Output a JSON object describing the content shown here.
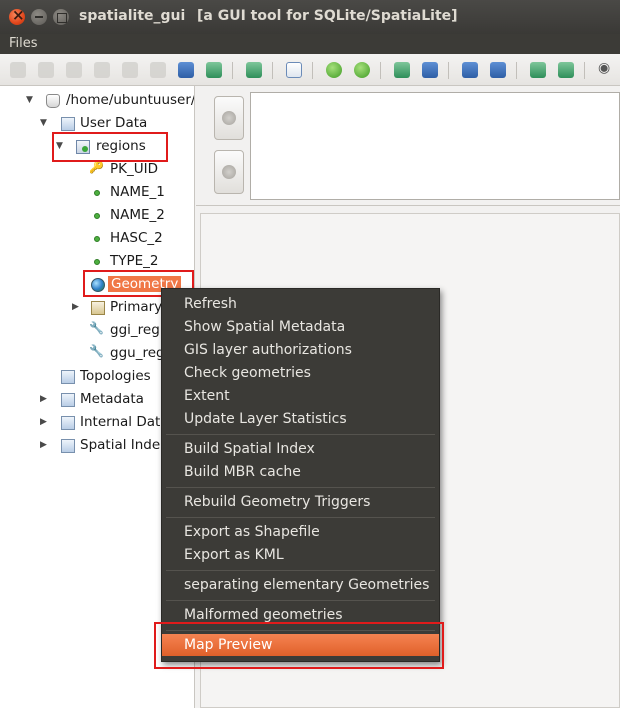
{
  "window": {
    "app_name": "spatialite_gui",
    "subtitle": "[a GUI tool for SQLite/SpatiaLite]"
  },
  "menubar": {
    "files": "Files"
  },
  "tree": {
    "root": "/home/ubuntuuser/",
    "user_data": "User Data",
    "regions": "regions",
    "columns": [
      "PK_UID",
      "NAME_1",
      "NAME_2",
      "HASC_2",
      "TYPE_2"
    ],
    "geometry": "Geometry",
    "primary": "Primary",
    "ggi": "ggi_reg",
    "ggu": "ggu_reg",
    "topologies": "Topologies",
    "metadata": "Metadata",
    "internal": "Internal Dat",
    "spatial_index": "Spatial Inde"
  },
  "context_menu": {
    "items": [
      "Refresh",
      "Show Spatial Metadata",
      "GIS layer authorizations",
      "Check geometries",
      "Extent",
      "Update Layer Statistics",
      "Build Spatial Index",
      "Build MBR cache",
      "Rebuild Geometry Triggers",
      "Export as Shapefile",
      "Export as KML",
      "separating elementary Geometries",
      "Malformed geometries",
      "Map Preview"
    ],
    "active": "Map Preview"
  },
  "colors": {
    "accent": "#e0602a",
    "highlight_box": "#e01b1b",
    "menu_bg": "#3c3b37",
    "titlebar": "#3c3b37"
  }
}
